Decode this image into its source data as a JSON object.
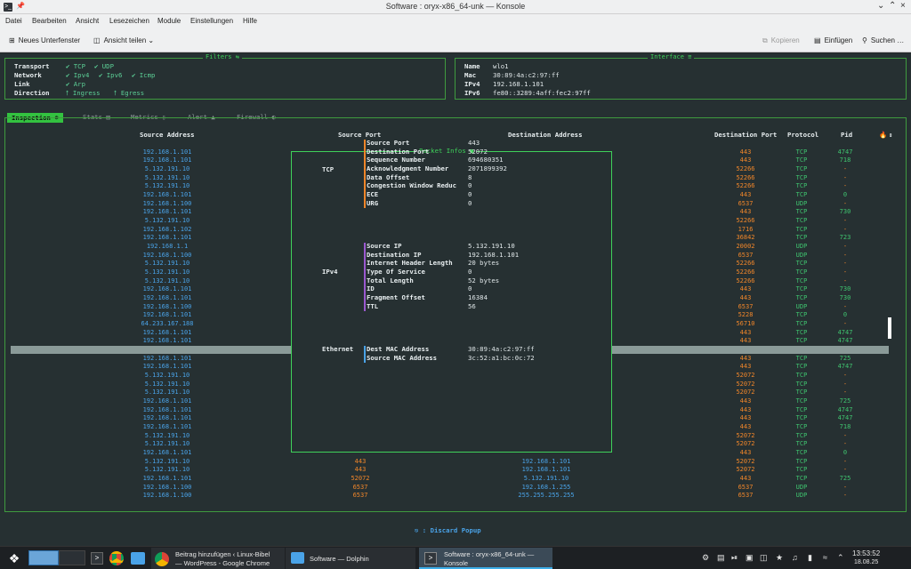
{
  "window": {
    "title": "Software : oryx-x86_64-unk — Konsole"
  },
  "menu": [
    "Datei",
    "Bearbeiten",
    "Ansicht",
    "Lesezeichen",
    "Module",
    "Einstellungen",
    "Hilfe"
  ],
  "toolbar": {
    "new_tab": "Neues Unterfenster",
    "split": "Ansicht teilen",
    "copy": "Kopieren",
    "paste": "Einfügen",
    "search": "Suchen …"
  },
  "filters": {
    "title": "Filters ⇆",
    "transport_label": "Transport",
    "transport_tcp": "✔ TCP",
    "transport_udp": "✔ UDP",
    "network_label": "Network",
    "network_ipv4": "✔ Ipv4",
    "network_ipv6": "✔ Ipv6",
    "network_icmp": "✔ Icmp",
    "link_label": "Link",
    "link_arp": "✔ Arp",
    "direction_label": "Direction",
    "dir_ingress": "⭡ Ingress",
    "dir_egress": "⭡ Egress"
  },
  "interface": {
    "title": "Interface ≡",
    "name_label": "Name",
    "name": "wlo1",
    "mac_label": "Mac",
    "mac": "30:89:4a:c2:97:ff",
    "ipv4_label": "IPv4",
    "ipv4": "192.168.1.101",
    "ipv6_label": "IPv6",
    "ipv6": "fe80::3289:4aff:fec2:97ff"
  },
  "tabs": {
    "inspection": "Inspection ☸",
    "stats": "Stats ▤",
    "metrics": "Metrics ▯",
    "alert": "Alert ▲",
    "firewall": "Firewall ◐"
  },
  "headers": {
    "src_addr": "Source Address",
    "src_port": "Source Port",
    "dst_addr": "Destination Address",
    "dst_port": "Destination Port",
    "protocol": "Protocol",
    "pid": "Pid",
    "arrow": "↕"
  },
  "rows": [
    {
      "src": "192.168.1.101",
      "dport": "443",
      "proto": "TCP",
      "pid": "4747"
    },
    {
      "src": "192.168.1.101",
      "dport": "443",
      "proto": "TCP",
      "pid": "718"
    },
    {
      "src": "5.132.191.10",
      "dport": "52266",
      "proto": "TCP",
      "pid": "-"
    },
    {
      "src": "5.132.191.10",
      "dport": "52266",
      "proto": "TCP",
      "pid": "-"
    },
    {
      "src": "5.132.191.10",
      "dport": "52266",
      "proto": "TCP",
      "pid": "-"
    },
    {
      "src": "192.168.1.101",
      "dport": "443",
      "proto": "TCP",
      "pid": "0"
    },
    {
      "src": "192.168.1.100",
      "dport": "6537",
      "proto": "UDP",
      "pid": "-"
    },
    {
      "src": "192.168.1.101",
      "dport": "443",
      "proto": "TCP",
      "pid": "730"
    },
    {
      "src": "5.132.191.10",
      "dport": "52266",
      "proto": "TCP",
      "pid": "-"
    },
    {
      "src": "192.168.1.102",
      "dport": "1716",
      "proto": "TCP",
      "pid": "-"
    },
    {
      "src": "192.168.1.101",
      "dport": "36842",
      "proto": "TCP",
      "pid": "723"
    },
    {
      "src": "192.168.1.1",
      "dport": "20002",
      "proto": "UDP",
      "pid": "-"
    },
    {
      "src": "192.168.1.100",
      "dport": "6537",
      "proto": "UDP",
      "pid": "-"
    },
    {
      "src": "5.132.191.10",
      "dport": "52266",
      "proto": "TCP",
      "pid": "-"
    },
    {
      "src": "5.132.191.10",
      "dport": "52266",
      "proto": "TCP",
      "pid": "-"
    },
    {
      "src": "5.132.191.10",
      "dport": "52266",
      "proto": "TCP",
      "pid": "-"
    },
    {
      "src": "192.168.1.101",
      "dport": "443",
      "proto": "TCP",
      "pid": "730"
    },
    {
      "src": "192.168.1.101",
      "dport": "443",
      "proto": "TCP",
      "pid": "730"
    },
    {
      "src": "192.168.1.100",
      "dport": "6537",
      "proto": "UDP",
      "pid": "-"
    },
    {
      "src": "192.168.1.101",
      "dport": "5228",
      "proto": "TCP",
      "pid": "0"
    },
    {
      "src": "64.233.167.188",
      "dport": "56710",
      "proto": "TCP",
      "pid": "-"
    },
    {
      "src": "192.168.1.101",
      "dport": "443",
      "proto": "TCP",
      "pid": "4747"
    },
    {
      "src": "192.168.1.101",
      "dport": "443",
      "proto": "TCP",
      "pid": "4747"
    },
    {
      "src": "",
      "dport": "",
      "proto": "",
      "pid": ""
    },
    {
      "src": "192.168.1.101",
      "dport": "443",
      "proto": "TCP",
      "pid": "725"
    },
    {
      "src": "192.168.1.101",
      "dport": "443",
      "proto": "TCP",
      "pid": "4747"
    },
    {
      "src": "5.132.191.10",
      "dport": "52072",
      "proto": "TCP",
      "pid": "-"
    },
    {
      "src": "5.132.191.10",
      "dport": "52072",
      "proto": "TCP",
      "pid": "-"
    },
    {
      "src": "5.132.191.10",
      "dport": "52072",
      "proto": "TCP",
      "pid": "-"
    },
    {
      "src": "192.168.1.101",
      "dport": "443",
      "proto": "TCP",
      "pid": "725"
    },
    {
      "src": "192.168.1.101",
      "dport": "443",
      "proto": "TCP",
      "pid": "4747"
    },
    {
      "src": "192.168.1.101",
      "dport": "443",
      "proto": "TCP",
      "pid": "4747"
    },
    {
      "src": "192.168.1.101",
      "dport": "443",
      "proto": "TCP",
      "pid": "718"
    },
    {
      "src": "5.132.191.10",
      "dport": "52072",
      "proto": "TCP",
      "pid": "-"
    },
    {
      "src": "5.132.191.10",
      "dport": "52072",
      "proto": "TCP",
      "pid": "-"
    },
    {
      "src": "192.168.1.101",
      "dport": "443",
      "proto": "TCP",
      "pid": "0"
    },
    {
      "src": "5.132.191.10",
      "sport": "443",
      "dst": "192.168.1.101",
      "dport": "52072",
      "proto": "TCP",
      "pid": "-"
    },
    {
      "src": "5.132.191.10",
      "sport": "443",
      "dst": "192.168.1.101",
      "dport": "52072",
      "proto": "TCP",
      "pid": "-"
    },
    {
      "src": "192.168.1.101",
      "sport": "52072",
      "dst": "5.132.191.10",
      "dport": "443",
      "proto": "TCP",
      "pid": "725"
    },
    {
      "src": "192.168.1.100",
      "sport": "6537",
      "dst": "192.168.1.255",
      "dport": "6537",
      "proto": "UDP",
      "pid": "-"
    },
    {
      "src": "192.168.1.100",
      "sport": "6537",
      "dst": "255.255.255.255",
      "dport": "6537",
      "proto": "UDP",
      "pid": "-"
    }
  ],
  "popup": {
    "title": "Packet Infos ●",
    "tcp": {
      "label": "TCP",
      "fields": [
        {
          "k": "Source Port",
          "v": "443"
        },
        {
          "k": "Destination Port",
          "v": "52072"
        },
        {
          "k": "Sequence Number",
          "v": "694680351"
        },
        {
          "k": "Acknowledgment Number",
          "v": "2071899392"
        },
        {
          "k": "Data Offset",
          "v": "8"
        },
        {
          "k": "Congestion Window Reduc",
          "v": "0"
        },
        {
          "k": "ECE",
          "v": "0"
        },
        {
          "k": "URG",
          "v": "0"
        }
      ]
    },
    "ipv4": {
      "label": "IPv4",
      "fields": [
        {
          "k": "Source IP",
          "v": "5.132.191.10"
        },
        {
          "k": "Destination IP",
          "v": "192.168.1.101"
        },
        {
          "k": "Internet Header Length",
          "v": "20 bytes"
        },
        {
          "k": "Type Of Service",
          "v": "0"
        },
        {
          "k": "Total Length",
          "v": "52 bytes"
        },
        {
          "k": "ID",
          "v": "0"
        },
        {
          "k": "Fragment Offset",
          "v": "16384"
        },
        {
          "k": "TTL",
          "v": "56"
        }
      ]
    },
    "ethernet": {
      "label": "Ethernet",
      "fields": [
        {
          "k": "Dest MAC Address",
          "v": "30:89:4a:c2:97:ff"
        },
        {
          "k": "Source MAC Address",
          "v": "3c:52:a1:bc:0c:72"
        }
      ]
    }
  },
  "footer": {
    "discard": "⎋ : Discard Popup"
  },
  "taskbar": {
    "chrome_line1": "Beitrag hinzufügen ‹ Linux-Bibel",
    "chrome_line2": "— WordPress - Google Chrome",
    "dolphin": "Software — Dolphin",
    "konsole_line1": "Software : oryx-x86_64-unk —",
    "konsole_line2": "Konsole",
    "time": "13:53:52",
    "date": "18.08.25"
  },
  "colors": {
    "accent": "#3fd15a",
    "blue": "#4aa3e8",
    "orange": "#f0862a",
    "green": "#3fc46f",
    "bg": "#263032"
  }
}
